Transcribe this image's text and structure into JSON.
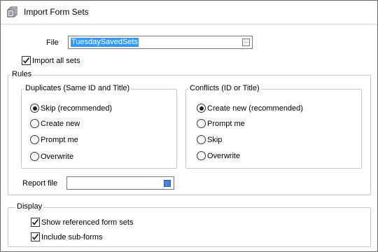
{
  "window": {
    "title": "Import Form Sets",
    "icon": "import-form-sets-icon"
  },
  "file": {
    "label": "File",
    "value": "TuesdaySavedSets",
    "browse_icon": "ellipsis-browse-icon"
  },
  "import_all": {
    "label": "Import all sets",
    "checked": true
  },
  "rules": {
    "legend": "Rules",
    "duplicates": {
      "legend": "Duplicates (Same ID and Title)",
      "options": [
        {
          "label": "Skip (recommended)",
          "selected": true
        },
        {
          "label": "Create new",
          "selected": false
        },
        {
          "label": "Prompt me",
          "selected": false
        },
        {
          "label": "Overwrite",
          "selected": false
        }
      ]
    },
    "conflicts": {
      "legend": "Conflicts (ID or Title)",
      "options": [
        {
          "label": "Create new (recommended)",
          "selected": true
        },
        {
          "label": "Prompt me",
          "selected": false
        },
        {
          "label": "Skip",
          "selected": false
        },
        {
          "label": "Overwrite",
          "selected": false
        }
      ]
    },
    "report_file": {
      "label": "Report file",
      "value": ""
    }
  },
  "display": {
    "legend": "Display",
    "show_referenced": {
      "label": "Show referenced form sets",
      "checked": true
    },
    "include_subforms": {
      "label": "Include sub-forms",
      "checked": true
    }
  },
  "colors": {
    "selection": "#3399ff",
    "border": "#c8c8c8"
  }
}
